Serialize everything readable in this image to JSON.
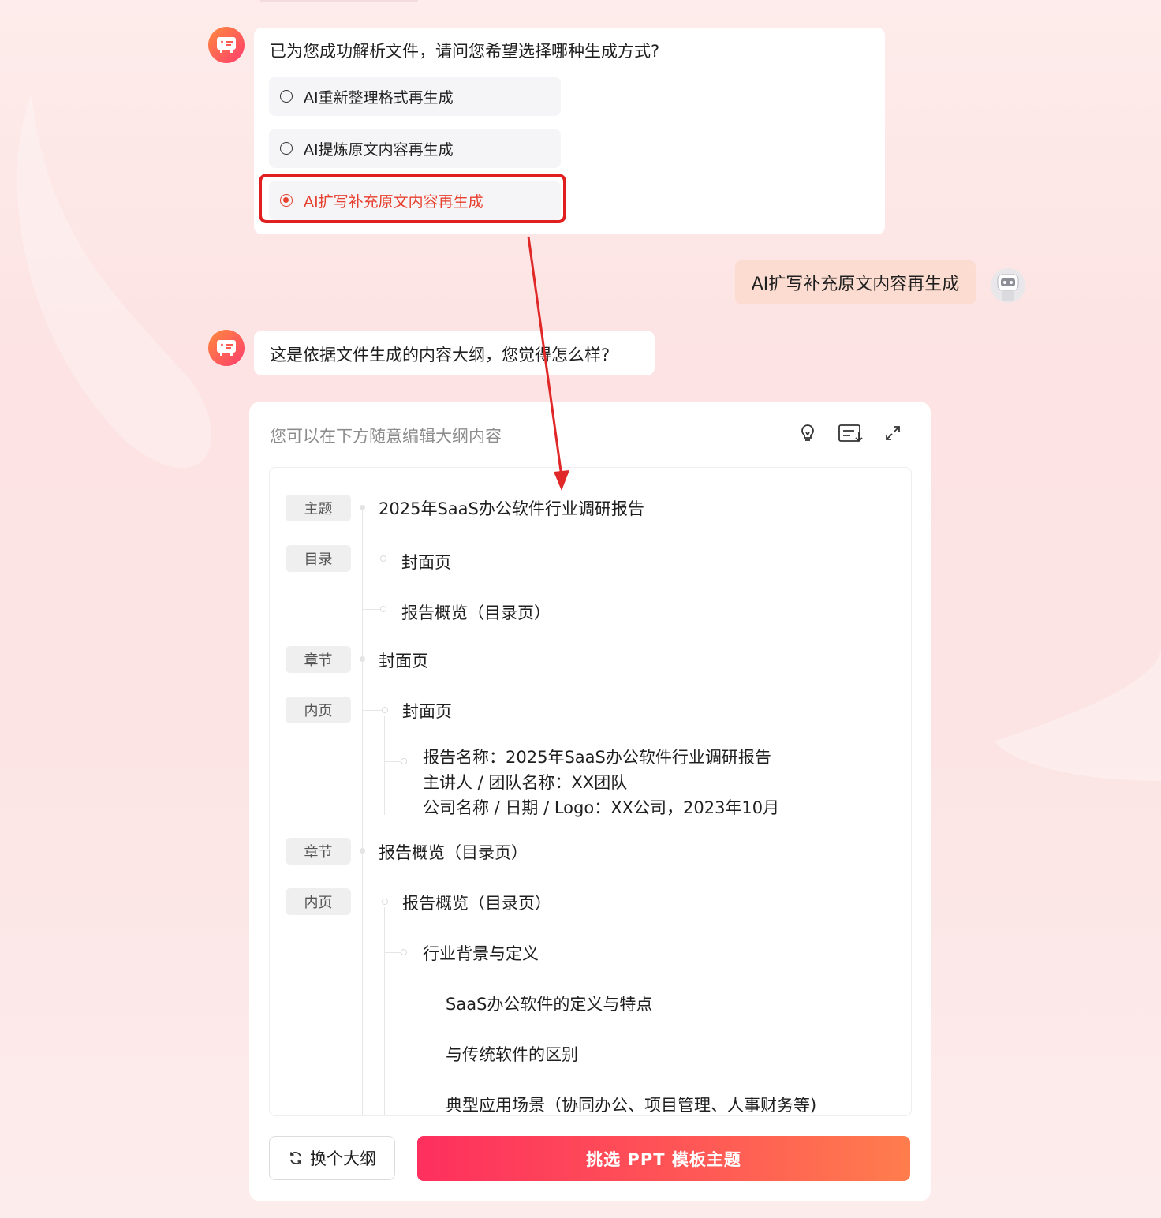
{
  "message1": {
    "question": "已为您成功解析文件，请问您希望选择哪种生成方式?",
    "options": [
      {
        "label": "AI重新整理格式再生成",
        "selected": false
      },
      {
        "label": "AI提炼原文内容再生成",
        "selected": false
      },
      {
        "label": "AI扩写补充原文内容再生成",
        "selected": true
      }
    ]
  },
  "user_reply": "AI扩写补充原文内容再生成",
  "message2": {
    "text": "这是依据文件生成的内容大纲，您觉得怎么样?"
  },
  "outline_card": {
    "hint": "您可以在下方随意编辑大纲内容",
    "tools": [
      "lightbulb-icon",
      "list-export-icon",
      "expand-icon"
    ],
    "tags": {
      "topic": "主题",
      "toc": "目录",
      "chapter1": "章节",
      "inner1": "内页",
      "chapter2": "章节",
      "inner2": "内页"
    },
    "items": {
      "topic": "2025年SaaS办公软件行业调研报告",
      "toc_1": "封面页",
      "toc_2": "报告概览（目录页）",
      "chapter1": "封面页",
      "inner1_title": "封面页",
      "inner1_line1": "报告名称：2025年SaaS办公软件行业调研报告",
      "inner1_line2": "主讲人 / 团队名称：XX团队",
      "inner1_line3": "公司名称 / 日期 / Logo：XX公司，2023年10月",
      "chapter2": "报告概览（目录页）",
      "inner2_title": "报告概览（目录页）",
      "inner2_sub": "行业背景与定义",
      "inner2_p1": "SaaS办公软件的定义与特点",
      "inner2_p2": "与传统软件的区别",
      "inner2_p3": "典型应用场景（协同办公、项目管理、人事财务等)"
    },
    "buttons": {
      "change_outline": "换个大纲",
      "pick_template": "挑选 PPT 模板主题"
    }
  },
  "colors": {
    "accent": "#e8402f",
    "highlight_box": "#e02020",
    "primary_gradient_start": "#fe2f5e",
    "primary_gradient_end": "#ff7d4d",
    "user_bubble": "#fcdcd0"
  }
}
